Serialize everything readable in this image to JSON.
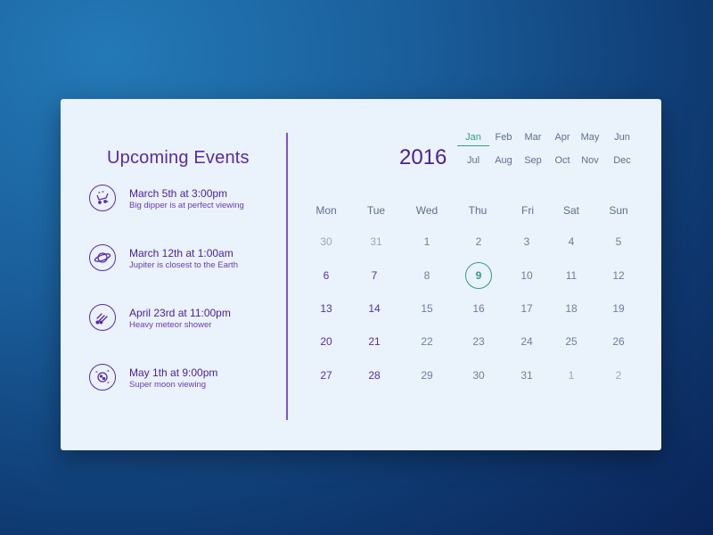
{
  "panel": {
    "title": "Upcoming Events",
    "events": [
      {
        "title": "March 5th at 3:00pm",
        "desc": "Big dipper is at perfect viewing",
        "icon": "telescope-icon"
      },
      {
        "title": "March 12th at 1:00am",
        "desc": "Jupiter is closest to the Earth",
        "icon": "planet-icon"
      },
      {
        "title": "April 23rd at 11:00pm",
        "desc": "Heavy meteor shower",
        "icon": "meteor-icon"
      },
      {
        "title": "May 1th at 9:00pm",
        "desc": "Super moon viewing",
        "icon": "moon-icon"
      }
    ]
  },
  "calendar": {
    "year": "2016",
    "months_row1": [
      "Jan",
      "Feb",
      "Mar",
      "Apr",
      "May",
      "Jun"
    ],
    "months_row2": [
      "Jul",
      "Aug",
      "Sep",
      "Oct",
      "Nov",
      "Dec"
    ],
    "selected_month": "Jan",
    "weekdays": [
      "Mon",
      "Tue",
      "Wed",
      "Thu",
      "Fri",
      "Sat",
      "Sun"
    ],
    "weeks": [
      [
        "30",
        "31",
        "1",
        "2",
        "3",
        "4",
        "5"
      ],
      [
        "6",
        "7",
        "8",
        "9",
        "10",
        "11",
        "12"
      ],
      [
        "13",
        "14",
        "15",
        "16",
        "17",
        "18",
        "19"
      ],
      [
        "20",
        "21",
        "22",
        "23",
        "24",
        "25",
        "26"
      ],
      [
        "27",
        "28",
        "29",
        "30",
        "31",
        "1",
        "2"
      ]
    ],
    "today": "9",
    "colors": {
      "accent": "#2aa08a",
      "primary": "#5a2aa0"
    }
  }
}
